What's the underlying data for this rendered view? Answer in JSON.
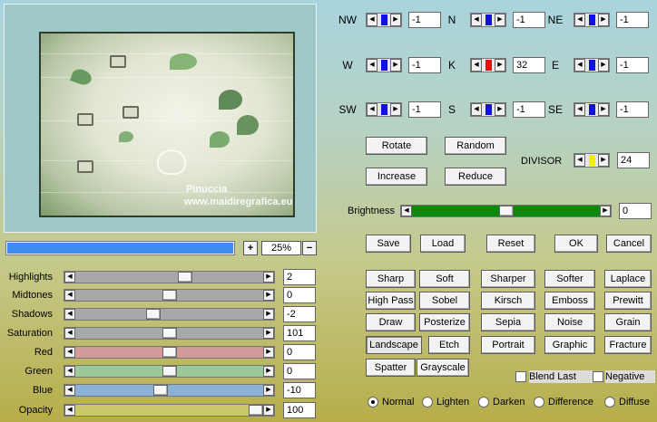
{
  "preview": {
    "watermark_name": "Pinuccia",
    "watermark_url": "www.maidiregrafica.eu"
  },
  "progress": {
    "fill": 1.0
  },
  "zoom": {
    "plus": "+",
    "minus": "−",
    "value": "25%"
  },
  "sliders": [
    {
      "label": "Highlights",
      "value": "2",
      "level": 0.59,
      "track_color": "#a8a8a8"
    },
    {
      "label": "Midtones",
      "value": "0",
      "level": 0.5,
      "track_color": "#a8a8a8"
    },
    {
      "label": "Shadows",
      "value": "-2",
      "level": 0.41,
      "track_color": "#a8a8a8"
    },
    {
      "label": "Saturation",
      "value": "101",
      "level": 0.5,
      "track_color": "#a8a8a8"
    },
    {
      "label": "Red",
      "value": "0",
      "level": 0.5,
      "track_color": "#d29a98"
    },
    {
      "label": "Green",
      "value": "0",
      "level": 0.5,
      "track_color": "#9cc99a"
    },
    {
      "label": "Blue",
      "value": "-10",
      "level": 0.45,
      "track_color": "#8cb1d6"
    },
    {
      "label": "Opacity",
      "value": "100",
      "level": 1.0,
      "track_color": "#cbc86a"
    }
  ],
  "matrix": {
    "cells": [
      {
        "label": "NW",
        "value": "-1",
        "color": "#1010e0"
      },
      {
        "label": "N",
        "value": "-1",
        "color": "#1010e0"
      },
      {
        "label": "NE",
        "value": "-1",
        "color": "#1010e0"
      },
      {
        "label": "W",
        "value": "-1",
        "color": "#1010e0"
      },
      {
        "label": "K",
        "value": "32",
        "color": "#e01010"
      },
      {
        "label": "E",
        "value": "-1",
        "color": "#1010e0"
      },
      {
        "label": "SW",
        "value": "-1",
        "color": "#1010e0"
      },
      {
        "label": "S",
        "value": "-1",
        "color": "#1010e0"
      },
      {
        "label": "SE",
        "value": "-1",
        "color": "#1010e0"
      }
    ],
    "divisor": {
      "label": "DIVISOR",
      "value": "24",
      "color": "#f0f000"
    }
  },
  "buttons_top": {
    "rotate": "Rotate",
    "random": "Random",
    "increase": "Increase",
    "reduce": "Reduce"
  },
  "brightness": {
    "label": "Brightness",
    "value": "0",
    "level": 0.5,
    "track_color": "#0a8a0a"
  },
  "actions": {
    "save": "Save",
    "load": "Load",
    "reset": "Reset",
    "ok": "OK",
    "cancel": "Cancel"
  },
  "presets": [
    [
      "Sharp",
      "Soft",
      "Sharper",
      "Softer",
      "Laplace"
    ],
    [
      "High Pass",
      "Sobel",
      "Kirsch",
      "Emboss",
      "Prewitt"
    ],
    [
      "Draw",
      "Posterize",
      "Sepia",
      "Noise",
      "Grain"
    ],
    [
      "Landscape",
      "Etch",
      "Portrait",
      "Graphic",
      "Fracture"
    ],
    [
      "Spatter",
      "Grayscale"
    ]
  ],
  "options": {
    "blend_last": "Blend Last",
    "negative": "Negative"
  },
  "modes": {
    "items": [
      "Normal",
      "Lighten",
      "Darken",
      "Difference",
      "Diffuse"
    ],
    "selected": "Normal"
  }
}
